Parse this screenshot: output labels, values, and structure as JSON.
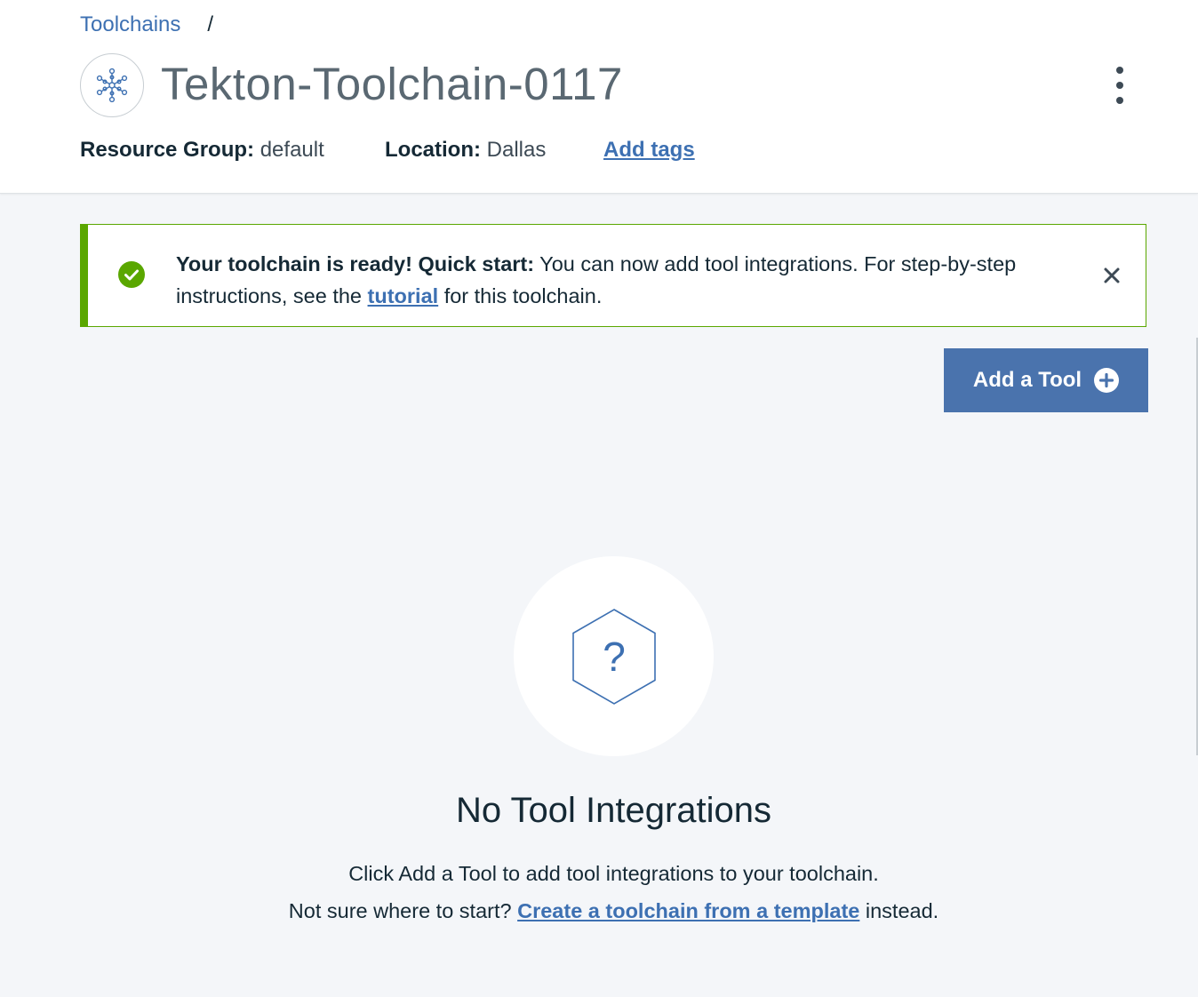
{
  "breadcrumb": {
    "parent": "Toolchains",
    "separator": "/"
  },
  "header": {
    "title": "Tekton-Toolchain-0117",
    "icon": "toolchain-network-icon",
    "overflow_icon": "overflow-menu-vertical-icon"
  },
  "meta": {
    "resource_group_label": "Resource Group:",
    "resource_group_value": "default",
    "location_label": "Location:",
    "location_value": "Dallas",
    "add_tags": "Add tags"
  },
  "notification": {
    "icon": "checkmark-filled-icon",
    "bold": "Your toolchain is ready! Quick start:",
    "text_before_link": " You can now add tool integrations. For step-by-step instructions, see the ",
    "link": "tutorial",
    "text_after_link": " for this toolchain.",
    "close_icon": "close-icon",
    "accent": "#5aa700"
  },
  "actions": {
    "add_tool": "Add a Tool",
    "add_tool_icon": "add-filled-icon",
    "button_color": "#4a73ad"
  },
  "empty_state": {
    "icon": "hexagon-question-icon",
    "title": "No Tool Integrations",
    "line1": "Click Add a Tool to add tool integrations to your toolchain.",
    "line2_before": "Not sure where to start? ",
    "line2_link": "Create a toolchain from a template",
    "line2_after": " instead."
  }
}
